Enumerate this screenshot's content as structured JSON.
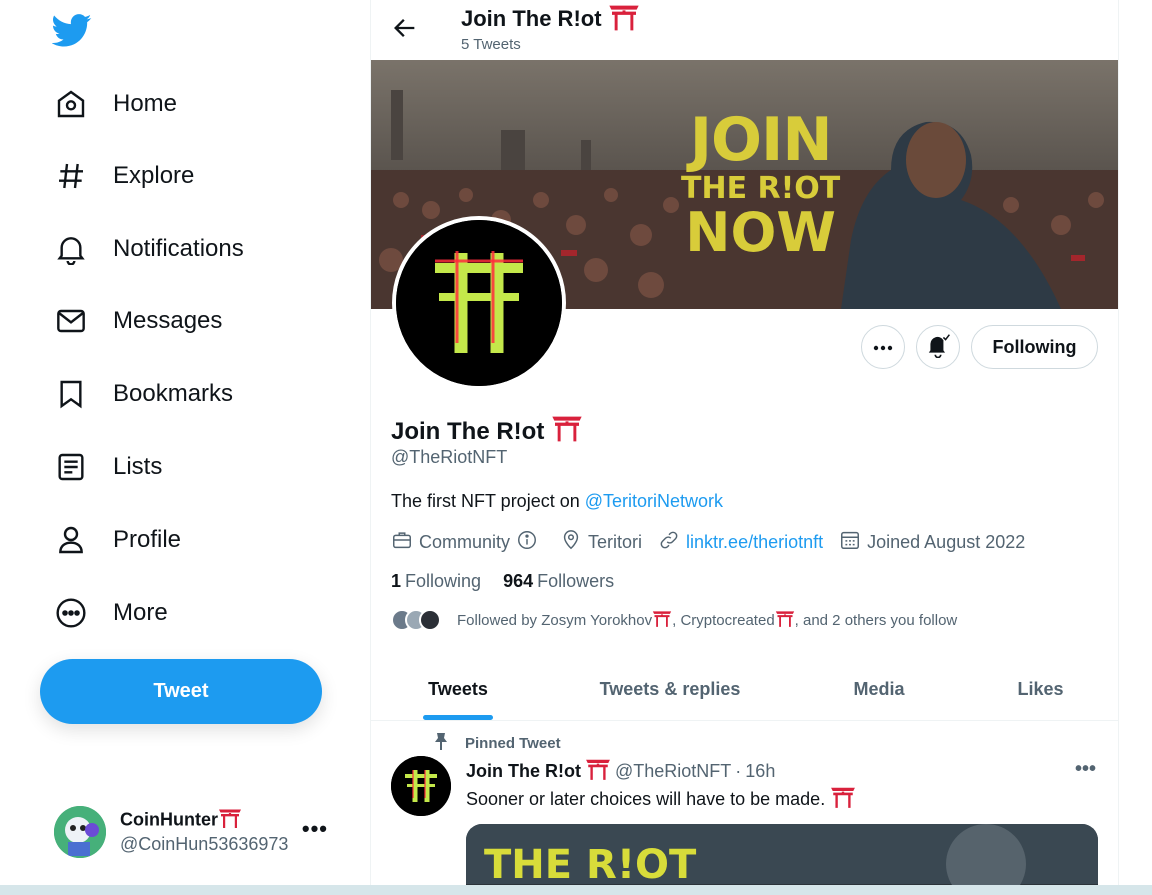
{
  "colors": {
    "accent": "#1d9bf0",
    "text": "#0f1419",
    "muted": "#536471",
    "torii": "#d9213c",
    "banner_text": "#d8cc3a"
  },
  "nav": {
    "items": [
      {
        "label": "Home",
        "icon": "home-icon"
      },
      {
        "label": "Explore",
        "icon": "hashtag-icon"
      },
      {
        "label": "Notifications",
        "icon": "bell-icon"
      },
      {
        "label": "Messages",
        "icon": "envelope-icon"
      },
      {
        "label": "Bookmarks",
        "icon": "bookmark-icon"
      },
      {
        "label": "Lists",
        "icon": "list-icon"
      },
      {
        "label": "Profile",
        "icon": "person-icon"
      },
      {
        "label": "More",
        "icon": "more-circle-icon"
      }
    ],
    "tweet_button": "Tweet"
  },
  "account": {
    "name": "CoinHunter",
    "handle": "@CoinHun53636973",
    "more": "•••"
  },
  "header": {
    "title": "Join The R!ot",
    "subtitle": "5 Tweets"
  },
  "banner": {
    "line1": "JOIN",
    "line2": "THE R!OT",
    "line3": "NOW"
  },
  "profile": {
    "name": "Join The R!ot",
    "handle": "@TheRiotNFT",
    "bio_prefix": "The first NFT project on ",
    "bio_link": "@TeritoriNetwork",
    "category": "Community",
    "location": "Teritori",
    "website": "linktr.ee/theriotnft",
    "joined": "Joined August 2022",
    "following_count": "1",
    "following_label": "Following",
    "followers_count": "964",
    "followers_label": "Followers",
    "followed_by_a": "Followed by Zosym Yorokhov",
    "followed_by_b": ", Cryptocreated ",
    "followed_by_c": ", and 2 others you follow",
    "follow_button": "Following"
  },
  "tabs": [
    {
      "label": "Tweets",
      "active": true
    },
    {
      "label": "Tweets & replies",
      "active": false
    },
    {
      "label": "Media",
      "active": false
    },
    {
      "label": "Likes",
      "active": false
    }
  ],
  "tweet": {
    "pinned_label": "Pinned Tweet",
    "author": "Join The R!ot",
    "handle": "@TheRiotNFT",
    "sep": "·",
    "time": "16h",
    "text": "Sooner or later choices will have to be made.",
    "media_text": "THE R!OT",
    "more": "•••"
  }
}
